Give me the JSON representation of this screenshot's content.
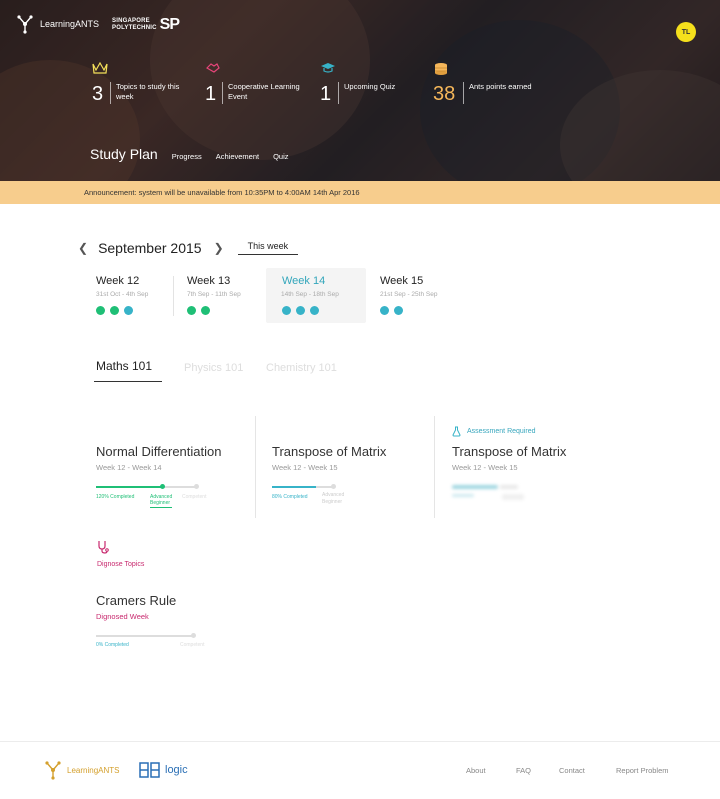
{
  "brand": {
    "name": "LearningANTS",
    "partner_line1": "SINGAPORE",
    "partner_line2": "POLYTECHNIC",
    "partner_mark": "SP"
  },
  "user": {
    "initials": "TL",
    "avatar_color": "#f5e01c"
  },
  "stats": [
    {
      "icon": "crown-icon",
      "value": "3",
      "label": "Topics to study this week",
      "accent": "#f4e05a"
    },
    {
      "icon": "handshake-icon",
      "value": "1",
      "label": "Cooperative Learning Event",
      "accent": "#e8457a"
    },
    {
      "icon": "graduation-cap-icon",
      "value": "1",
      "label": "Upcoming Quiz",
      "accent": "#37b3c8"
    },
    {
      "icon": "coins-icon",
      "value": "38",
      "label": "Ants points earned",
      "accent": "#f4b65a"
    }
  ],
  "subnav": {
    "title": "Study Plan",
    "links": [
      "Progress",
      "Achievement",
      "Quiz"
    ]
  },
  "announcement": "Announcement: system will be unavailable from 10:35PM to 4:00AM 14th Apr 2016",
  "calendar": {
    "month": "September 2015",
    "this_week": "This week",
    "weeks": [
      {
        "title": "Week 12",
        "dates": "31st Oct - 4th Sep",
        "dots": [
          "green",
          "green",
          "teal"
        ]
      },
      {
        "title": "Week 13",
        "dates": "7th Sep - 11th Sep",
        "dots": [
          "green",
          "green"
        ]
      },
      {
        "title": "Week 14",
        "dates": "14th Sep - 18th Sep",
        "dots": [
          "teal",
          "teal",
          "teal"
        ]
      },
      {
        "title": "Week 15",
        "dates": "21st Sep - 25th Sep",
        "dots": [
          "teal",
          "teal"
        ]
      }
    ]
  },
  "tabs": [
    "Maths 101",
    "Physics 101",
    "Chemistry 101"
  ],
  "topics": [
    {
      "title": "Normal Differentiation",
      "weeks": "Week 12 - Week 14",
      "progress_label": "120% Completed",
      "level_label_1": "Advanced",
      "level_label_2": "Beginner",
      "end_label": "Competent",
      "fill": 0.7,
      "color": "#1fbf76"
    },
    {
      "title": "Transpose of Matrix",
      "weeks": "Week 12 - Week 15",
      "progress_label": "80% Completed",
      "level_label_1": "Advanced",
      "level_label_2": "Beginner",
      "fill": 0.7,
      "color": "#37b3c8"
    },
    {
      "title": "Transpose of Matrix",
      "weeks": "Week 12 - Week 15",
      "badge": "Assessment Required"
    }
  ],
  "diagnose": {
    "label": "Dignose Topics",
    "title": "Cramers Rule",
    "subtitle": "Dignosed Week",
    "progress_label": "0% Completed",
    "end_label": "Competent",
    "fill": 0.0,
    "color": "#c8296e"
  },
  "footer": {
    "brand": "LearningANTS",
    "partner": "logic",
    "links": [
      "About",
      "FAQ",
      "Contact",
      "Report Problem"
    ]
  }
}
